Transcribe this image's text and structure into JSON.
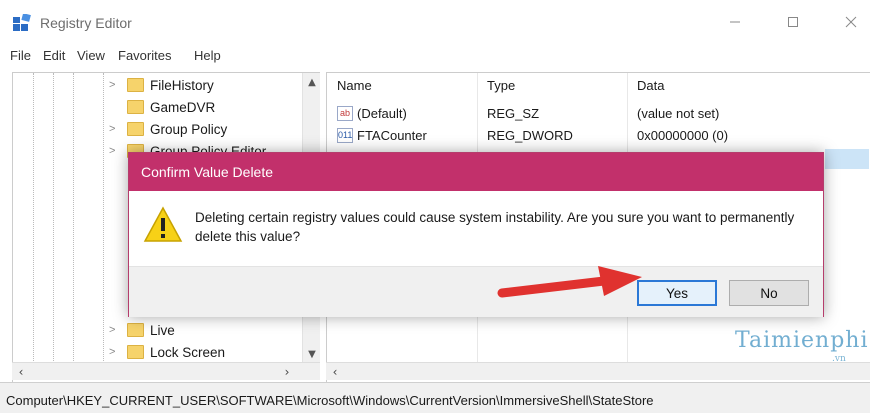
{
  "window": {
    "title": "Registry Editor"
  },
  "menu": [
    "File",
    "Edit",
    "View",
    "Favorites",
    "Help"
  ],
  "tree": {
    "items_top": [
      {
        "label": "FileHistory",
        "expander": ">"
      },
      {
        "label": "GameDVR",
        "expander": ""
      },
      {
        "label": "Group Policy",
        "expander": ">"
      },
      {
        "label": "Group Policy Editor",
        "expander": ">"
      }
    ],
    "items_bottom": [
      {
        "label": "Live",
        "expander": ">"
      },
      {
        "label": "Lock Screen",
        "expander": ">"
      }
    ]
  },
  "list": {
    "columns": [
      "Name",
      "Type",
      "Data"
    ],
    "rows": [
      {
        "icon": "ab",
        "name": "(Default)",
        "type": "REG_SZ",
        "data": "(value not set)"
      },
      {
        "icon": "011",
        "name": "FTACounter",
        "type": "REG_DWORD",
        "data": "0x00000000 (0)"
      }
    ]
  },
  "status": {
    "path": "Computer\\HKEY_CURRENT_USER\\SOFTWARE\\Microsoft\\Windows\\CurrentVersion\\ImmersiveShell\\StateStore"
  },
  "dialog": {
    "title": "Confirm Value Delete",
    "message": "Deleting certain registry values could cause system instability. Are you sure you want to permanently delete this value?",
    "yes_label": "Yes",
    "no_label": "No"
  },
  "watermark": {
    "text": "Taimienphi",
    "sub": ".vn"
  },
  "colors": {
    "dialog_title": "#c2306b",
    "arrow": "#e0322f",
    "default_border": "#2b78d6"
  },
  "icons": {
    "app": "registry-editor-icon",
    "warning": "warning-triangle-icon",
    "folder": "folder-icon",
    "string_value": "reg-sz-icon",
    "dword_value": "reg-dword-icon"
  }
}
